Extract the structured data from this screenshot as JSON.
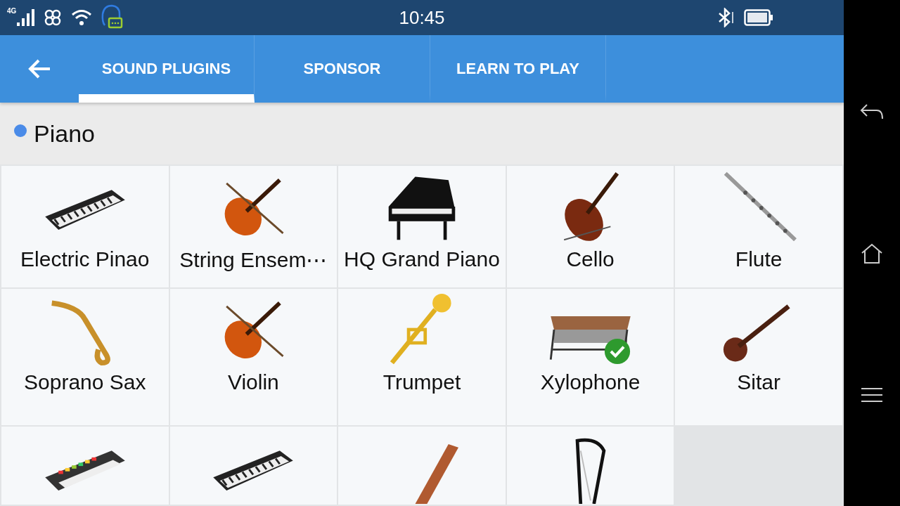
{
  "status_bar": {
    "network_type": "4G",
    "time": "10:45"
  },
  "tabs": [
    {
      "label": "SOUND PLUGINS",
      "selected": true
    },
    {
      "label": "SPONSOR",
      "selected": false
    },
    {
      "label": "LEARN TO PLAY",
      "selected": false
    }
  ],
  "section": {
    "title": "Piano",
    "color": "#4a8be8"
  },
  "instruments": [
    {
      "kind": "keyboard",
      "label": "Electric Pinao",
      "selected": false
    },
    {
      "kind": "violin",
      "label": "String Ensem⋯",
      "selected": false
    },
    {
      "kind": "grand-piano",
      "label": "HQ Grand Piano",
      "selected": false
    },
    {
      "kind": "cello",
      "label": "Cello",
      "selected": false
    },
    {
      "kind": "flute",
      "label": "Flute",
      "selected": false
    },
    {
      "kind": "saxophone",
      "label": "Soprano Sax",
      "selected": false
    },
    {
      "kind": "violin",
      "label": "Violin",
      "selected": false
    },
    {
      "kind": "trumpet",
      "label": "Trumpet",
      "selected": false
    },
    {
      "kind": "xylophone",
      "label": "Xylophone",
      "selected": true
    },
    {
      "kind": "sitar",
      "label": "Sitar",
      "selected": false
    },
    {
      "kind": "pad-keyboard",
      "selected": false
    },
    {
      "kind": "keyboard",
      "selected": false
    },
    {
      "kind": "guzheng",
      "selected": false
    },
    {
      "kind": "harp",
      "selected": false
    }
  ]
}
